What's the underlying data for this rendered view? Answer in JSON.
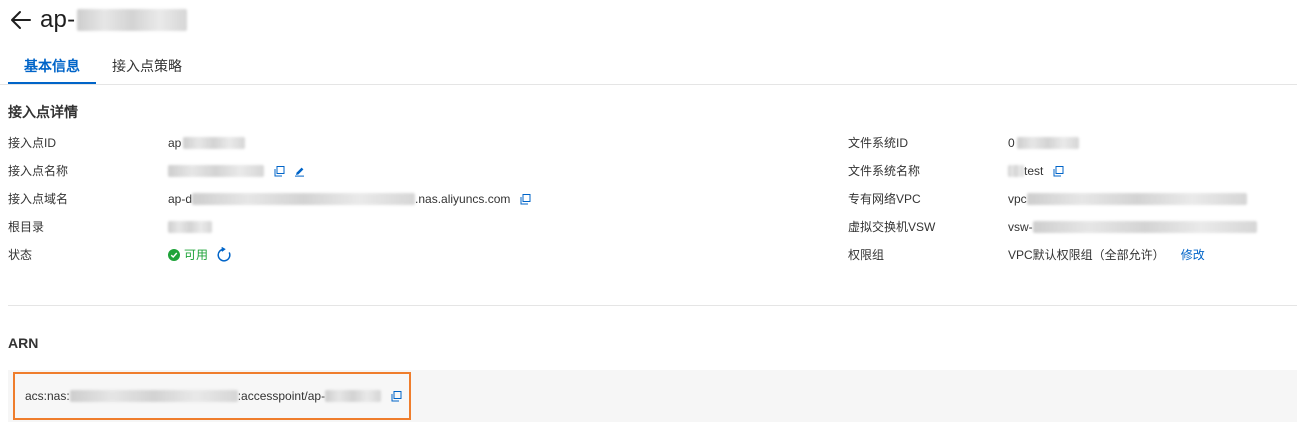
{
  "header": {
    "title_prefix": "ap-",
    "back_icon": "arrow-left-icon"
  },
  "tabs": [
    {
      "label": "基本信息",
      "active": true
    },
    {
      "label": "接入点策略",
      "active": false
    }
  ],
  "details": {
    "section_title": "接入点详情",
    "left": [
      {
        "label": "接入点ID",
        "value": "ap"
      },
      {
        "label": "接入点名称",
        "value": ""
      },
      {
        "label": "接入点域名",
        "value_prefix": "ap-d",
        "value_suffix": ".nas.aliyuncs.com"
      },
      {
        "label": "根目录",
        "value": ""
      },
      {
        "label": "状态",
        "value": "可用"
      }
    ],
    "right": [
      {
        "label": "文件系统ID",
        "value": "0"
      },
      {
        "label": "文件系统名称",
        "value": "test"
      },
      {
        "label": "专有网络VPC",
        "value": "vpc"
      },
      {
        "label": "虚拟交换机VSW",
        "value": "vsw-"
      },
      {
        "label": "权限组",
        "value": "VPC默认权限组（全部允许）",
        "link": "修改"
      }
    ]
  },
  "arn": {
    "section_title": "ARN",
    "prefix": "acs:nas:",
    "middle": ":accesspoint/ap-"
  },
  "colors": {
    "accent": "#0064c8",
    "status_ok": "#1fa33a",
    "highlight_border": "#ef7d2c"
  }
}
